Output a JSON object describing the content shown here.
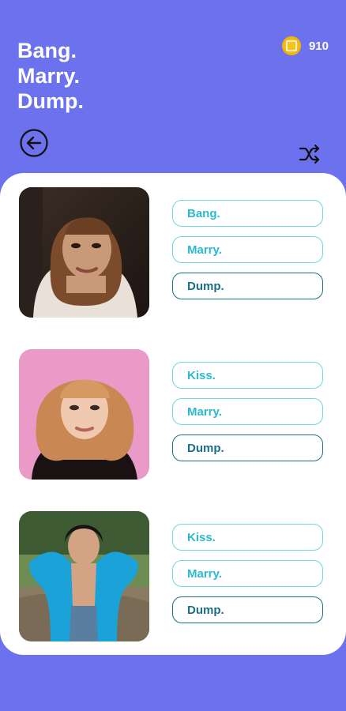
{
  "header": {
    "title_lines": [
      "Bang.",
      "Marry.",
      "Dump."
    ],
    "coin_count": "910",
    "back_icon": "back-arrow-icon",
    "shuffle_icon": "shuffle-icon"
  },
  "rows": [
    {
      "photo": "person-photo-1",
      "options": [
        {
          "label": "Bang.",
          "style": "light"
        },
        {
          "label": "Marry.",
          "style": "light"
        },
        {
          "label": "Dump.",
          "style": "dark"
        }
      ]
    },
    {
      "photo": "person-photo-2",
      "options": [
        {
          "label": "Kiss.",
          "style": "light"
        },
        {
          "label": "Marry.",
          "style": "light"
        },
        {
          "label": "Dump.",
          "style": "dark"
        }
      ]
    },
    {
      "photo": "person-photo-3",
      "options": [
        {
          "label": "Kiss.",
          "style": "light"
        },
        {
          "label": "Marry.",
          "style": "light"
        },
        {
          "label": "Dump.",
          "style": "dark"
        }
      ]
    }
  ],
  "colors": {
    "background": "#6c72ee",
    "card": "#ffffff",
    "button_light": "#2bbad0",
    "button_dark": "#1b6f86",
    "coin": "#f6c21c"
  }
}
